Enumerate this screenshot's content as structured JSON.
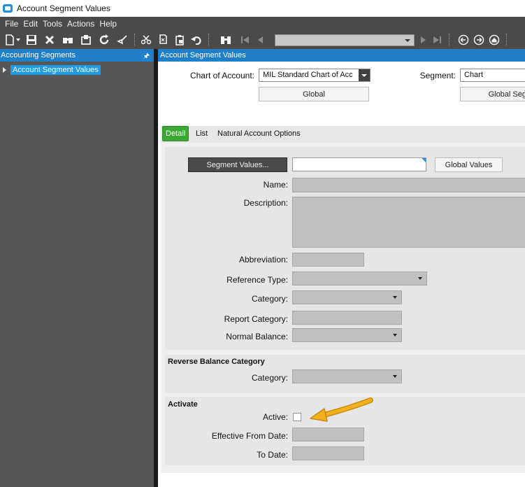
{
  "window": {
    "title": "Account Segment Values"
  },
  "menu": [
    "File",
    "Edit",
    "Tools",
    "Actions",
    "Help"
  ],
  "toolbar": {
    "icons": [
      "new-icon",
      "dropdown-icon",
      "save-icon",
      "delete-icon",
      "binoculars-icon",
      "attach-icon",
      "refresh-icon",
      "clear-icon",
      "cut-icon",
      "copy-icon",
      "paste-icon",
      "undo-icon",
      "find-icon",
      "first-record-icon",
      "prev-record-icon",
      "next-record-icon",
      "last-record-icon",
      "back-icon",
      "forward-icon",
      "home-icon"
    ],
    "record_selector_value": ""
  },
  "left_panel": {
    "title": "Accounting Segments",
    "tree": [
      {
        "label": "Account Segment Values",
        "selected": true
      }
    ]
  },
  "main": {
    "title": "Account Segment Values",
    "chart_of_account": {
      "label": "Chart of Account:",
      "value": "MIL Standard Chart of Acc",
      "global_button": "Global"
    },
    "segment": {
      "label": "Segment:",
      "value": "Chart",
      "global_button": "Global Seg"
    },
    "tabs": [
      {
        "label": "Detail",
        "active": true
      },
      {
        "label": "List",
        "active": false
      },
      {
        "label": "Natural Account Options",
        "active": false
      }
    ],
    "detail": {
      "segment_values_button": "Segment Values...",
      "segment_values_value": "",
      "global_values_button": "Global Values",
      "name_label": "Name:",
      "description_label": "Description:",
      "abbreviation_label": "Abbreviation:",
      "reference_type_label": "Reference Type:",
      "category_label": "Category:",
      "report_category_label": "Report Category:",
      "normal_balance_label": "Normal Balance:"
    },
    "reverse_balance": {
      "title": "Reverse Balance Category",
      "category_label": "Category:"
    },
    "activate": {
      "title": "Activate",
      "active_label": "Active:",
      "active_checked": false,
      "effective_from_label": "Effective From Date:",
      "to_date_label": "To Date:"
    }
  },
  "colors": {
    "accent": "#1f7fc9",
    "active_tab": "#3aaa35",
    "annotation_arrow": "#f2b01e"
  }
}
